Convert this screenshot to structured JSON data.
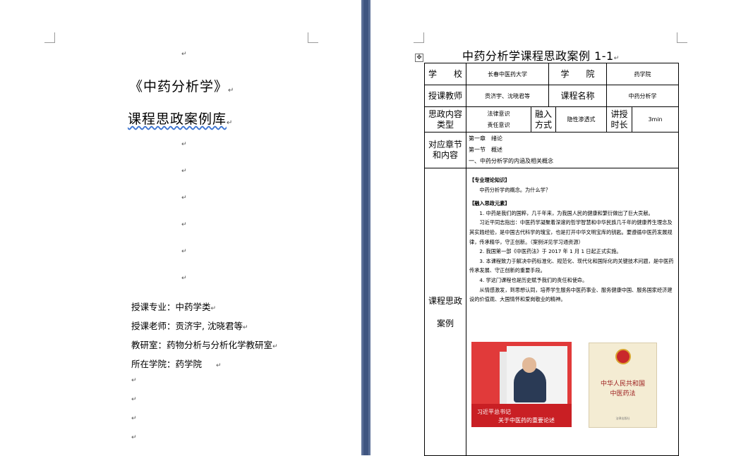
{
  "mark": "↵",
  "left": {
    "title": "《中药分析学》",
    "subtitle": "课程思政案例库",
    "info": [
      "授课专业：中药学类",
      "授课老师：贡济宇, 沈晓君等",
      "教研室：药物分析与分析化学教研室",
      "所在学院：药学院"
    ]
  },
  "right": {
    "title": "中药分析学课程思政案例 1-1",
    "anchor_icon": "move-handle-icon",
    "table": {
      "school_label": "学　　校",
      "school_value": "长春中医药大学",
      "college_label": "学　　院",
      "college_value": "药学院",
      "teacher_label": "授课教师",
      "teacher_value": "贡济宇、沈晓君等",
      "course_label": "课程名称",
      "course_value": "中药分析学",
      "sz_content_label": "思政内容类型",
      "sz_content_values": [
        "法律意识",
        "责任意识"
      ],
      "integration_label": "融入方式",
      "integration_value": "隐性渗透式",
      "duration_label": "讲授时长",
      "duration_value": "3min",
      "chapter_label": "对应章节和内容",
      "chapter_lines": [
        "第一章　绪论",
        "第一节　概述",
        "一、中药分析学的内涵及相关概念"
      ],
      "case_label_1": "课程思政",
      "case_label_2": "案例",
      "case_paras": [
        "【专业理论知识】",
        "中药分析学的概念。为什么学？",
        "【融入思政元素】",
        "1. 中药是我们的国粹，几千年来，为我国人民的健康和繁衍做出了巨大贡献。",
        "习近平同志指出：中医药学凝聚着深邃的哲学智慧和中华民族几千年的健康养生理念及其实践经验，是中国古代科学的瑰宝，也是打开中华文明宝库的钥匙。要遵循中医药发展规律，传承精华，守正创新。（案例详见学习通资源）",
        "2. 我国第一部《中医药法》于 2017 年 1 月 1 日起正式实施。",
        "3. 本课程致力于解决中药标准化、规范化、现代化和国际化的关键技术问题，是中医药传承发展、守正创新的重要手段。",
        "4. 学这门课程也是历史赋予我们的责任和使命。",
        "从情感激发，到思想认同，培养学生服务中医药事业、服务健康中国、服务国家经济建设的价值观、大国情怀和爱岗敬业的精神。"
      ],
      "image1_caption_1": "习近平总书记",
      "image1_caption_2": "关于中医药的重要论述",
      "image2_title_1": "中华人民共和国",
      "image2_title_2": "中医药法",
      "image2_footer": "法律出版社"
    }
  }
}
